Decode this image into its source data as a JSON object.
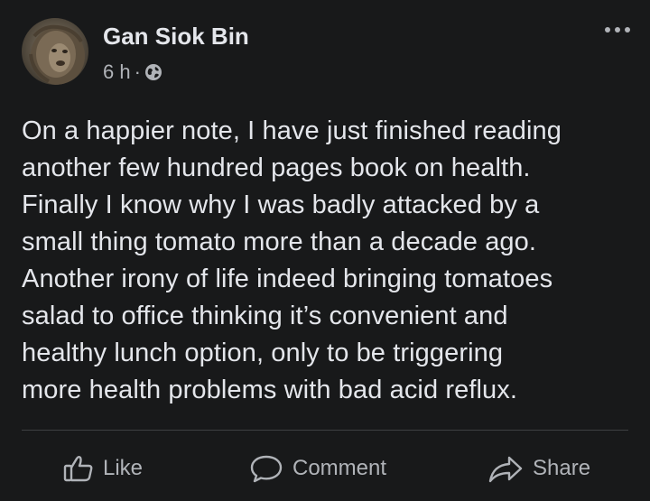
{
  "post": {
    "author": "Gan Siok Bin",
    "time": "6 h",
    "separator": "·",
    "privacy_icon": "globe-icon",
    "more_icon": "more-options-icon",
    "text": "On a happier note, I have just finished reading\nanother few hundred pages book on health.\nFinally I know why I was badly attacked by a\nsmall thing tomato more than a decade ago.\nAnother irony of life indeed bringing tomatoes\nsalad to office thinking it’s convenient and\nhealthy lunch option, only to be triggering\nmore health problems with bad acid reflux."
  },
  "actions": {
    "like": "Like",
    "comment": "Comment",
    "share": "Share"
  },
  "colors": {
    "background": "#18191a",
    "primary_text": "#e4e6eb",
    "secondary_text": "#b0b3b8",
    "divider": "#3e4042"
  }
}
